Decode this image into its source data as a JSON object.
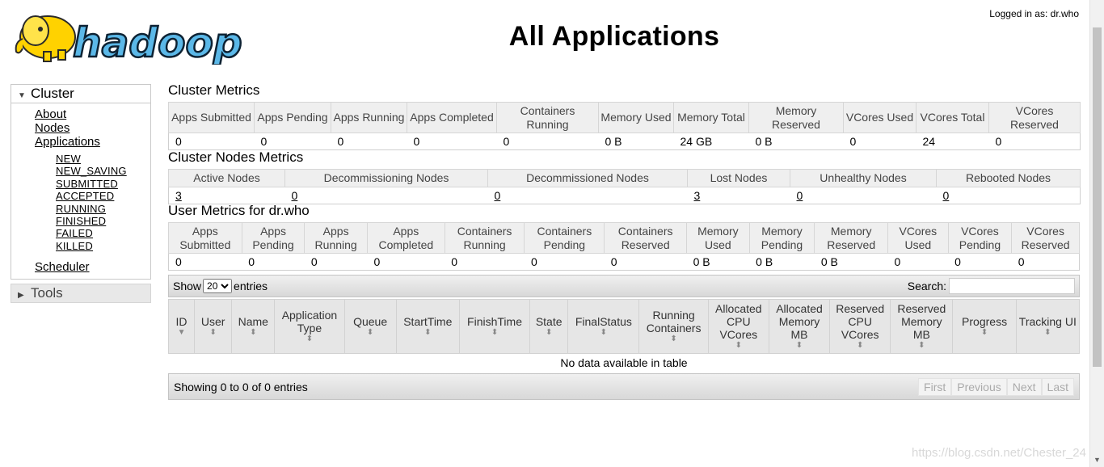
{
  "header": {
    "logo_text": "hadoop",
    "title": "All Applications",
    "login_label": "Logged in as: dr.who"
  },
  "sidebar": {
    "cluster": {
      "label": "Cluster",
      "links": [
        "About",
        "Nodes",
        "Applications"
      ],
      "app_states": [
        "NEW",
        "NEW_SAVING",
        "SUBMITTED",
        "ACCEPTED",
        "RUNNING",
        "FINISHED",
        "FAILED",
        "KILLED"
      ],
      "scheduler": "Scheduler"
    },
    "tools": {
      "label": "Tools"
    }
  },
  "cluster_metrics": {
    "title": "Cluster Metrics",
    "headers": [
      "Apps Submitted",
      "Apps Pending",
      "Apps Running",
      "Apps Completed",
      "Containers Running",
      "Memory Used",
      "Memory Total",
      "Memory Reserved",
      "VCores Used",
      "VCores Total",
      "VCores Reserved"
    ],
    "values": [
      "0",
      "0",
      "0",
      "0",
      "0",
      "0 B",
      "24 GB",
      "0 B",
      "0",
      "24",
      "0"
    ]
  },
  "cluster_nodes_metrics": {
    "title": "Cluster Nodes Metrics",
    "headers": [
      "Active Nodes",
      "Decommissioning Nodes",
      "Decommissioned Nodes",
      "Lost Nodes",
      "Unhealthy Nodes",
      "Rebooted Nodes"
    ],
    "values": [
      "3",
      "0",
      "0",
      "3",
      "0",
      "0"
    ]
  },
  "user_metrics": {
    "title": "User Metrics for dr.who",
    "headers": [
      "Apps Submitted",
      "Apps Pending",
      "Apps Running",
      "Apps Completed",
      "Containers Running",
      "Containers Pending",
      "Containers Reserved",
      "Memory Used",
      "Memory Pending",
      "Memory Reserved",
      "VCores Used",
      "VCores Pending",
      "VCores Reserved"
    ],
    "values": [
      "0",
      "0",
      "0",
      "0",
      "0",
      "0",
      "0",
      "0 B",
      "0 B",
      "0 B",
      "0",
      "0",
      "0"
    ]
  },
  "apps_table": {
    "show_label": "Show",
    "entries_value": "20",
    "entries_label": "entries",
    "search_label": "Search:",
    "search_value": "",
    "columns": [
      "ID",
      "User",
      "Name",
      "Application Type",
      "Queue",
      "StartTime",
      "FinishTime",
      "State",
      "FinalStatus",
      "Running Containers",
      "Allocated CPU VCores",
      "Allocated Memory MB",
      "Reserved CPU VCores",
      "Reserved Memory MB",
      "Progress",
      "Tracking UI"
    ],
    "empty_message": "No data available in table",
    "info": "Showing 0 to 0 of 0 entries",
    "pager": [
      "First",
      "Previous",
      "Next",
      "Last"
    ]
  },
  "watermark": "https://blog.csdn.net/Chester_24"
}
